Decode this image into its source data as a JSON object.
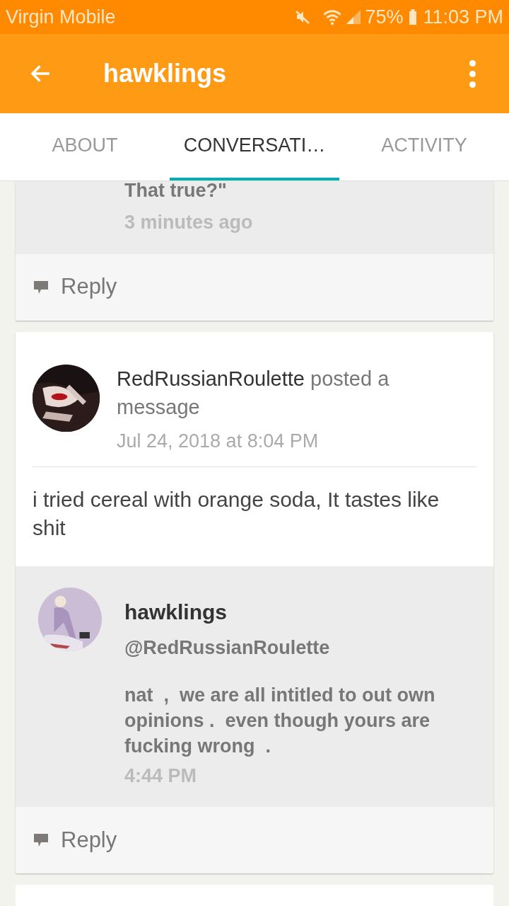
{
  "status_bar": {
    "carrier": "Virgin Mobile",
    "battery": "75%",
    "time": "11:03 PM"
  },
  "app_bar": {
    "title": "hawklings"
  },
  "tabs": [
    {
      "label": "ABOUT",
      "selected": false
    },
    {
      "label": "CONVERSATI…",
      "selected": true
    },
    {
      "label": "ACTIVITY",
      "selected": false
    }
  ],
  "posts": [
    {
      "partial": true,
      "replies": [
        {
          "text_tail": "That true?\"",
          "time": "3 minutes ago"
        }
      ],
      "reply_button": "Reply"
    },
    {
      "partial": false,
      "author": "RedRussianRoulette",
      "action": "posted a message",
      "date": "Jul 24, 2018 at 8:04 PM",
      "message": "i tried cereal with orange soda, It tastes like shit",
      "replies": [
        {
          "author": "hawklings",
          "mention": "@RedRussianRoulette",
          "text": "nat  ,  we are all intitled to out own opinions .  even though yours are fucking wrong  .",
          "time": "4:44 PM"
        }
      ],
      "reply_button": "Reply"
    }
  ]
}
